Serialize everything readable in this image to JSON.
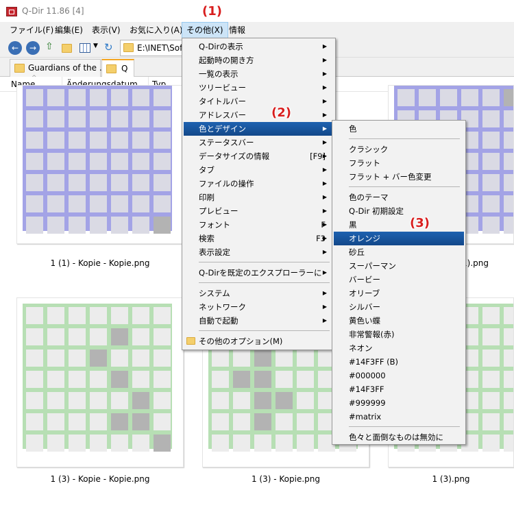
{
  "window": {
    "title": "Q-Dir 11.86 [4]"
  },
  "callouts": [
    "(1)",
    "(2)",
    "(3)"
  ],
  "menubar": [
    "ファイル(F)",
    "編集(E)",
    "表示(V)",
    "お気に入り(A)",
    "その他(X)",
    "情報"
  ],
  "toolbar": {
    "address": "E:\\INET\\Soft"
  },
  "tabs": [
    "Guardians of the ...",
    "Q"
  ],
  "columns": [
    "Name",
    "Änderungsdatum",
    "Typ"
  ],
  "files": [
    "1 (1) - Kopie - Kopie.png",
    "1).png",
    "1 (3) - Kopie - Kopie.png",
    "1 (3) - Kopie.png",
    "1 (3).png"
  ],
  "colors": {
    "accent": "#1e62b0",
    "purple_bg": "#a3a3e6",
    "purple_cell": "#dadae4",
    "green_bg": "#b7dfb4",
    "green_cell": "#ececec",
    "dark_cell": "#b3b3b3",
    "callout": "#d81e1e"
  },
  "main_menu": [
    {
      "label": "Q-Dirの表示",
      "arrow": true
    },
    {
      "label": "起動時の開き方",
      "arrow": true
    },
    {
      "label": "一覧の表示",
      "arrow": true
    },
    {
      "label": "ツリービュー",
      "arrow": true
    },
    {
      "label": "タイトルバー",
      "arrow": true
    },
    {
      "label": "アドレスバー",
      "arrow": true
    },
    {
      "label": "色とデザイン",
      "arrow": true
    },
    {
      "label": "ステータスバー",
      "arrow": true
    },
    {
      "label": "データサイズの情報",
      "shortcut": "[F9]",
      "arrow": true
    },
    {
      "label": "タブ",
      "arrow": true
    },
    {
      "label": "ファイルの操作",
      "arrow": true
    },
    {
      "label": "印刷",
      "arrow": true
    },
    {
      "label": "プレビュー",
      "arrow": true
    },
    {
      "label": "フォント",
      "shortcut": "F",
      "arrow": true
    },
    {
      "label": "検索",
      "shortcut": "F3",
      "arrow": true
    },
    {
      "label": "表示設定",
      "arrow": true
    },
    {
      "label": "Q-Dirを既定のエクスプローラーに",
      "arrow": true
    },
    {
      "label": "システム",
      "arrow": true
    },
    {
      "label": "ネットワーク",
      "arrow": true
    },
    {
      "label": "自動で起動",
      "arrow": true
    },
    {
      "label": "その他のオプション(M)",
      "arrow": false
    }
  ],
  "sub_menu": [
    "色",
    "クラシック",
    "フラット",
    "フラット + バー色変更",
    "色のテーマ",
    "Q-Dir 初期設定",
    "黒",
    "オレンジ",
    "砂丘",
    "スーパーマン",
    "バービー",
    "オリーブ",
    "シルバー",
    "黄色い蝶",
    "非常警報(赤)",
    "ネオン",
    "#14F3FF (B)",
    "#000000",
    "#14F3FF",
    "#999999",
    "#matrix",
    "色々と面倒なものは無効に"
  ]
}
